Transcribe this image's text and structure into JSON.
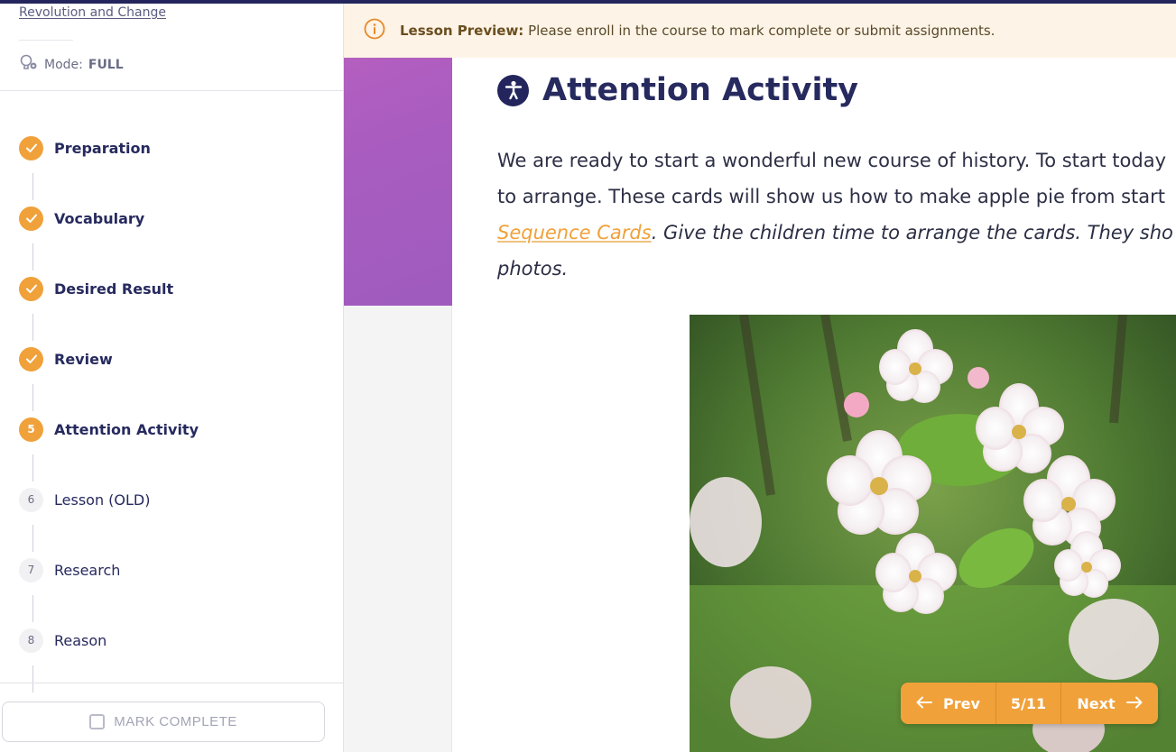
{
  "course": {
    "title_link": "Revolution and Change"
  },
  "mode": {
    "label": "Mode:",
    "value": "FULL"
  },
  "steps": [
    {
      "number": "1",
      "label": "Preparation",
      "status": "complete"
    },
    {
      "number": "2",
      "label": "Vocabulary",
      "status": "complete"
    },
    {
      "number": "3",
      "label": "Desired Result",
      "status": "complete"
    },
    {
      "number": "4",
      "label": "Review",
      "status": "complete"
    },
    {
      "number": "5",
      "label": "Attention Activity",
      "status": "current"
    },
    {
      "number": "6",
      "label": "Lesson (OLD)",
      "status": "todo"
    },
    {
      "number": "7",
      "label": "Research",
      "status": "todo"
    },
    {
      "number": "8",
      "label": "Reason",
      "status": "todo"
    }
  ],
  "mark_complete": {
    "label": "MARK COMPLETE",
    "checked": false
  },
  "banner": {
    "title": "Lesson Preview:",
    "message": "Please enroll in the course to mark complete or submit assignments."
  },
  "section": {
    "title": "Attention Activity",
    "lines": [
      "We are ready to start a wonderful new course of history. To start today",
      "to arrange. These cards will show us how to make apple pie from start"
    ],
    "link_text": "Sequence Cards",
    "after_link": ". Give the children time to arrange the cards. They sho",
    "last_line": "photos."
  },
  "pager": {
    "prev_label": "Prev",
    "position": "5/11",
    "next_label": "Next"
  },
  "colors": {
    "accent": "#f0a13a",
    "navy": "#262a5e",
    "purple": "#a85cbf",
    "banner_bg": "#fdf3e6"
  }
}
